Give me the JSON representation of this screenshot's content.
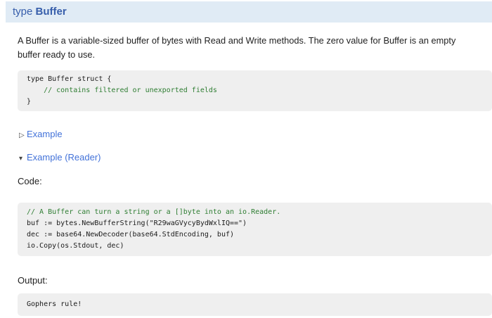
{
  "heading": {
    "keyword": "type",
    "type_name": "Buffer"
  },
  "description": "A Buffer is a variable-sized buffer of bytes with Read and Write methods. The zero value for Buffer is an empty buffer ready to use.",
  "type_decl": {
    "line_open": "type Buffer struct {",
    "line_comment": "    // contains filtered or unexported fields",
    "line_close": "}"
  },
  "examples": {
    "collapsed": {
      "icon": "triangle-right-icon",
      "glyph": "▷",
      "label": "Example"
    },
    "expanded": {
      "icon": "triangle-down-icon",
      "glyph": "▾",
      "label": "Example (Reader)"
    }
  },
  "code_section": {
    "label": "Code:",
    "comment_line": "// A Buffer can turn a string or a []byte into an io.Reader.",
    "lines": [
      "buf := bytes.NewBufferString(\"R29waGVycyBydWxlIQ==\")",
      "dec := base64.NewDecoder(base64.StdEncoding, buf)",
      "io.Copy(os.Stdout, dec)"
    ]
  },
  "output_section": {
    "label": "Output:",
    "text": "Gophers rule!"
  },
  "colors": {
    "heading_bg": "#E0EBF5",
    "heading_text": "#375EAB",
    "link": "#4272D9",
    "code_bg": "#EFEFEF",
    "code_text": "#1B1B1B",
    "comment": "#2E7D32"
  }
}
